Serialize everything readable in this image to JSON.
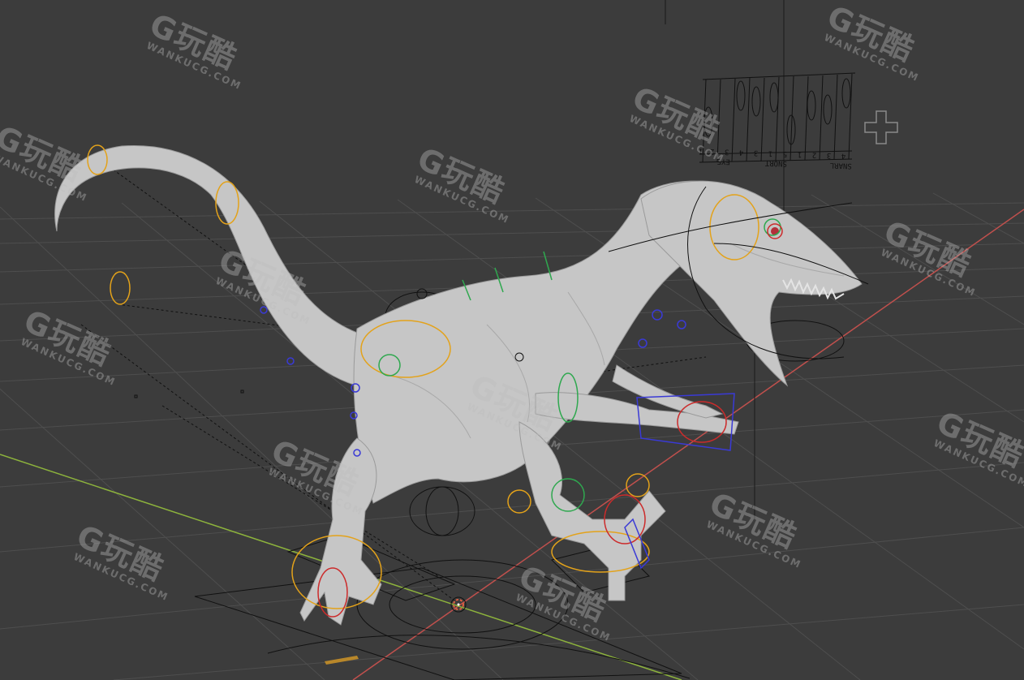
{
  "viewport": {
    "background": "#3c3c3c",
    "grid_color": "#505050",
    "x_axis_color": "#c0504d",
    "y_axis_color": "#8db33c",
    "mesh_color": "#c8c8c8"
  },
  "face_panel": {
    "labels": [
      "EYE",
      "SNORT",
      "SNARL"
    ],
    "numbers": [
      "4",
      "3",
      "2",
      "1",
      "5",
      "1",
      "3",
      "4",
      "3",
      "2",
      "1"
    ]
  },
  "watermark": {
    "logo_text": "G玩酷",
    "sub_text": "WANKUCG.COM",
    "color": "#bdbdbd"
  },
  "rig_colors": {
    "ik_control": "#e3a21a",
    "fk_control": "#2fa84f",
    "deform": "#cc2b2b",
    "tweak": "#3a3ad6",
    "line": "#111111"
  }
}
